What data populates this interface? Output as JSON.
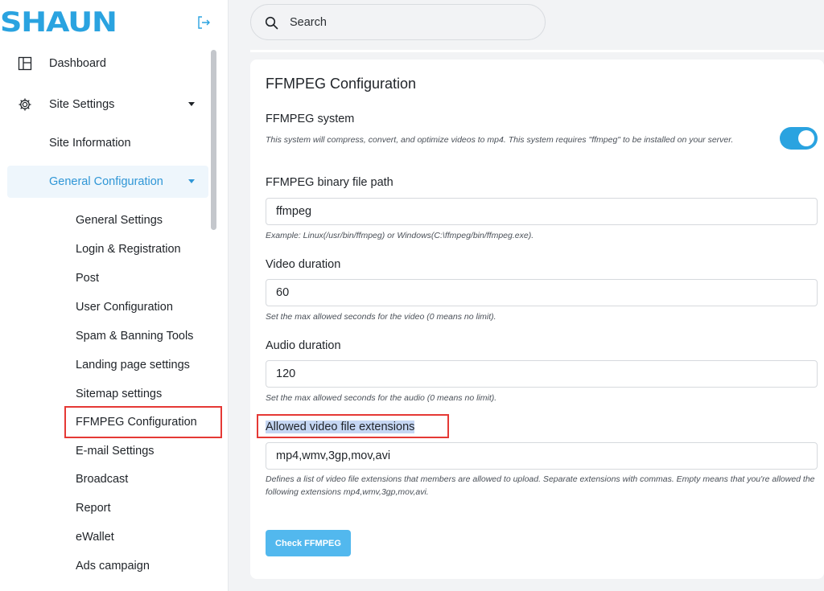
{
  "app": {
    "logo_text": "SHAUN",
    "brand_color": "#2aa3e0"
  },
  "sidebar": {
    "items": [
      {
        "label": "Dashboard",
        "icon": "layout-icon"
      },
      {
        "label": "Site Settings",
        "icon": "gear-icon"
      },
      {
        "label": "Site Information"
      },
      {
        "label": "General Configuration"
      }
    ],
    "sub_items": [
      "General Settings",
      "Login & Registration",
      "Post",
      "User Configuration",
      "Spam & Banning Tools",
      "Landing page settings",
      "Sitemap settings",
      "FFMPEG Configuration",
      "E-mail Settings",
      "Broadcast",
      "Report",
      "eWallet",
      "Ads campaign"
    ]
  },
  "search": {
    "placeholder": "Search"
  },
  "card": {
    "title": "FFMPEG Configuration",
    "system": {
      "label": "FFMPEG system",
      "help": "This system will compress, convert, and optimize videos to mp4. This system requires \"ffmpeg\" to be installed on your server.",
      "enabled": true
    },
    "binary_path": {
      "label": "FFMPEG binary file path",
      "value": "ffmpeg",
      "help": "Example: Linux(/usr/bin/ffmpeg) or Windows(C:\\ffmpeg/bin/ffmpeg.exe)."
    },
    "video_duration": {
      "label": "Video duration",
      "value": "60",
      "help": "Set the max allowed seconds for the video (0 means no limit)."
    },
    "audio_duration": {
      "label": "Audio duration",
      "value": "120",
      "help": "Set the max allowed seconds for the audio (0 means no limit)."
    },
    "extensions": {
      "label": "Allowed video file extensions",
      "value": "mp4,wmv,3gp,mov,avi",
      "help": "Defines a list of video file extensions that members are allowed to upload. Separate extensions with commas. Empty means that you're allowed the following extensions mp4,wmv,3gp,mov,avi."
    },
    "check_button": "Check FFMPEG"
  }
}
